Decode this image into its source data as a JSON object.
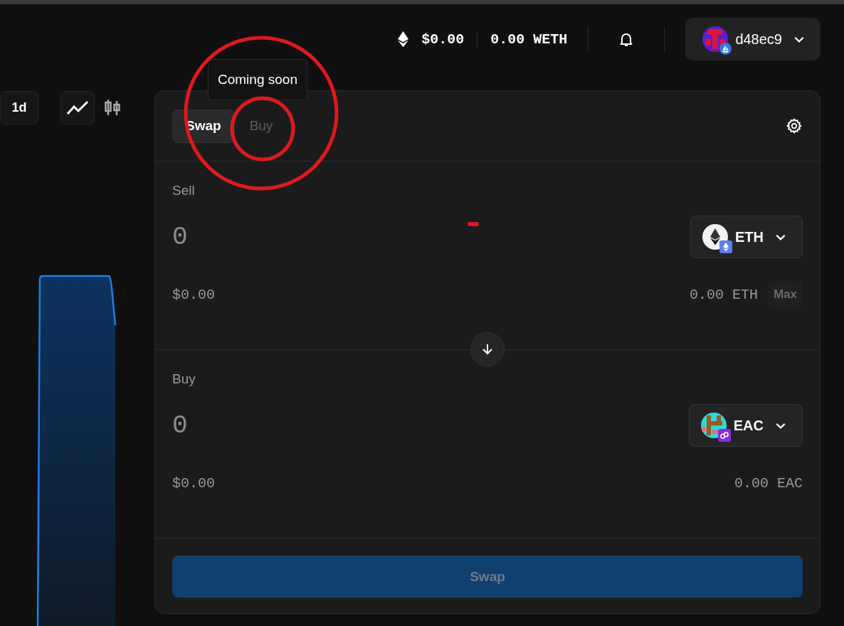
{
  "wallet": {
    "usd": "$0.00",
    "balance": "0.00 WETH",
    "account": "d48ec9"
  },
  "chart_controls": {
    "interval": "1d",
    "chart_types": [
      {
        "kind": "line",
        "selected": true
      },
      {
        "kind": "candles",
        "selected": false
      }
    ]
  },
  "tooltip": "Coming soon",
  "tabs": [
    {
      "label": "Swap",
      "selected": true,
      "disabled": false
    },
    {
      "label": "Buy",
      "selected": false,
      "disabled": true
    }
  ],
  "sections": [
    {
      "label": "Sell",
      "amount": "0",
      "usd": "$0.00",
      "token": {
        "kind": "eth",
        "symbol": "ETH"
      },
      "balance": "0.00 ETH",
      "max": "Max"
    },
    {
      "label": "Buy",
      "amount": "0",
      "usd": "$0.00",
      "token": {
        "kind": "eac",
        "symbol": "EAC"
      },
      "balance": "0.00 EAC"
    }
  ],
  "swap_button": {
    "label": "Swap",
    "disabled": true
  }
}
